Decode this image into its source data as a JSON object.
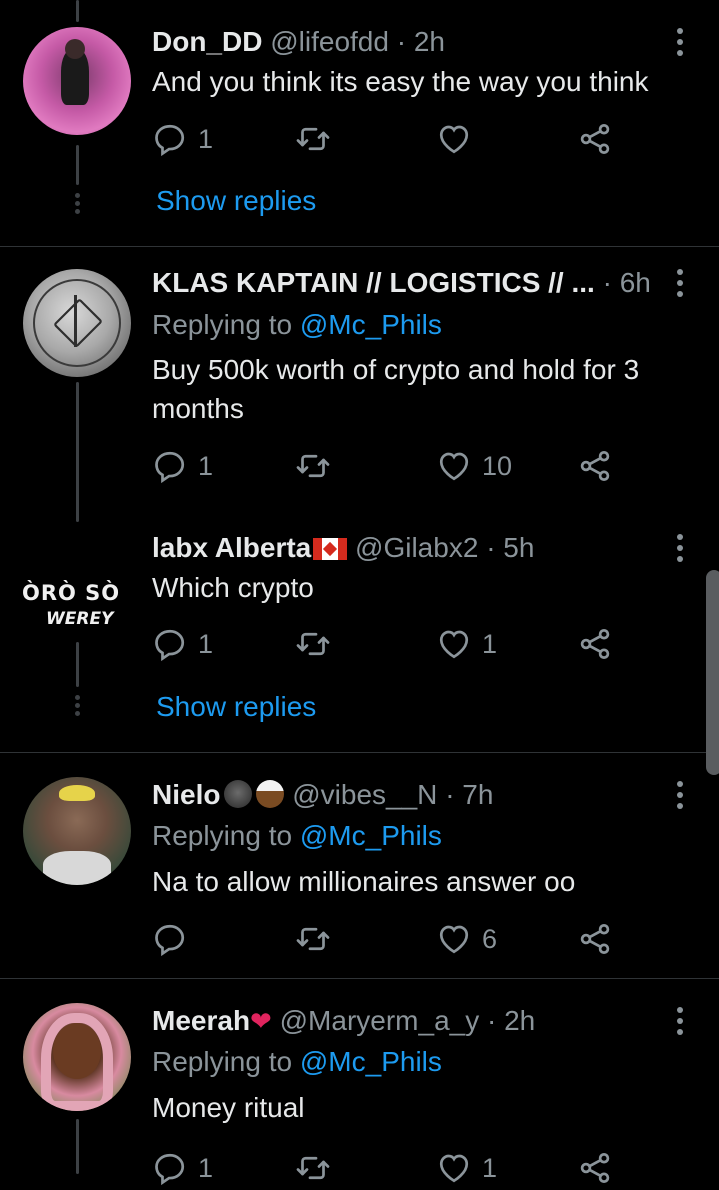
{
  "tweets": [
    {
      "name": "Don_DD",
      "handle": "@lifeofdd",
      "time": "· 2h",
      "text": "And you think its easy the way you think",
      "replies": "1",
      "retweets": "",
      "likes": "",
      "show_replies": "Show replies"
    },
    {
      "name": "KLAS KAPTAIN // LOGISTICS // ...",
      "time": "· 6h",
      "replying_prefix": "Replying to ",
      "replying_to": "@Mc_Phils",
      "text": "Buy 500k worth of crypto and hold for 3 months",
      "replies": "1",
      "retweets": "",
      "likes": "10"
    },
    {
      "name": "labx Alberta",
      "handle": "@Gilabx2",
      "time": "· 5h",
      "text": "Which crypto",
      "replies": "1",
      "retweets": "",
      "likes": "1",
      "show_replies": "Show replies",
      "avatar_text_1": "ÒRÒ SÒ",
      "avatar_text_2": "WEREY"
    },
    {
      "name": "Nielo",
      "handle": "@vibes__N",
      "time": "· 7h",
      "replying_prefix": "Replying to ",
      "replying_to": "@Mc_Phils",
      "text": "Na to allow millionaires answer oo",
      "replies": "",
      "retweets": "",
      "likes": "6"
    },
    {
      "name": "Meerah",
      "handle": "@Maryerm_a_y",
      "time": "· 2h",
      "replying_prefix": "Replying to ",
      "replying_to": "@Mc_Phils",
      "text": "Money ritual",
      "replies": "1",
      "retweets": "",
      "likes": "1"
    }
  ],
  "colors": {
    "background": "#000000",
    "text": "#e7e9ea",
    "secondary": "#8b949a",
    "link": "#1d9bf0",
    "divider": "#2f3336"
  },
  "icons": [
    "reply-icon",
    "retweet-icon",
    "like-icon",
    "share-icon",
    "more-icon"
  ]
}
